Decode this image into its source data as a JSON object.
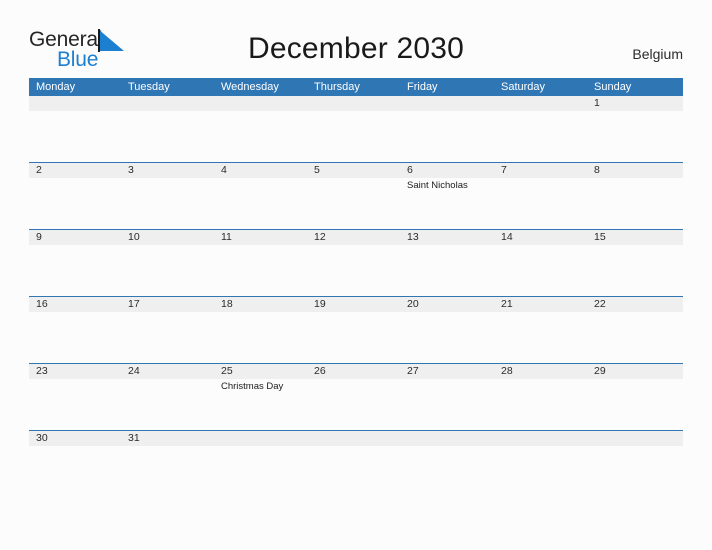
{
  "brand": {
    "name_part1": "General",
    "name_part2": "Blue",
    "triangle_icon": "triangle-flag-icon",
    "accent_color": "#1d7fd0"
  },
  "header": {
    "title": "December 2030",
    "country": "Belgium"
  },
  "theme": {
    "header_blue": "#2f76b4",
    "band_gray": "#efefef",
    "page_background": "#fcfcfc",
    "text_dark": "#2b2b2b"
  },
  "calendar": {
    "month": "December",
    "year": "2030",
    "weekday_headers": [
      "Monday",
      "Tuesday",
      "Wednesday",
      "Thursday",
      "Friday",
      "Saturday",
      "Sunday"
    ],
    "weeks": [
      {
        "short": false,
        "cells": [
          {
            "day": "",
            "events": []
          },
          {
            "day": "",
            "events": []
          },
          {
            "day": "",
            "events": []
          },
          {
            "day": "",
            "events": []
          },
          {
            "day": "",
            "events": []
          },
          {
            "day": "",
            "events": []
          },
          {
            "day": "1",
            "events": []
          }
        ]
      },
      {
        "short": false,
        "cells": [
          {
            "day": "2",
            "events": []
          },
          {
            "day": "3",
            "events": []
          },
          {
            "day": "4",
            "events": []
          },
          {
            "day": "5",
            "events": []
          },
          {
            "day": "6",
            "events": [
              "Saint Nicholas"
            ]
          },
          {
            "day": "7",
            "events": []
          },
          {
            "day": "8",
            "events": []
          }
        ]
      },
      {
        "short": false,
        "cells": [
          {
            "day": "9",
            "events": []
          },
          {
            "day": "10",
            "events": []
          },
          {
            "day": "11",
            "events": []
          },
          {
            "day": "12",
            "events": []
          },
          {
            "day": "13",
            "events": []
          },
          {
            "day": "14",
            "events": []
          },
          {
            "day": "15",
            "events": []
          }
        ]
      },
      {
        "short": false,
        "cells": [
          {
            "day": "16",
            "events": []
          },
          {
            "day": "17",
            "events": []
          },
          {
            "day": "18",
            "events": []
          },
          {
            "day": "19",
            "events": []
          },
          {
            "day": "20",
            "events": []
          },
          {
            "day": "21",
            "events": []
          },
          {
            "day": "22",
            "events": []
          }
        ]
      },
      {
        "short": false,
        "cells": [
          {
            "day": "23",
            "events": []
          },
          {
            "day": "24",
            "events": []
          },
          {
            "day": "25",
            "events": [
              "Christmas Day"
            ]
          },
          {
            "day": "26",
            "events": []
          },
          {
            "day": "27",
            "events": []
          },
          {
            "day": "28",
            "events": []
          },
          {
            "day": "29",
            "events": []
          }
        ]
      },
      {
        "short": true,
        "cells": [
          {
            "day": "30",
            "events": []
          },
          {
            "day": "31",
            "events": []
          },
          {
            "day": "",
            "events": []
          },
          {
            "day": "",
            "events": []
          },
          {
            "day": "",
            "events": []
          },
          {
            "day": "",
            "events": []
          },
          {
            "day": "",
            "events": []
          }
        ]
      }
    ]
  }
}
